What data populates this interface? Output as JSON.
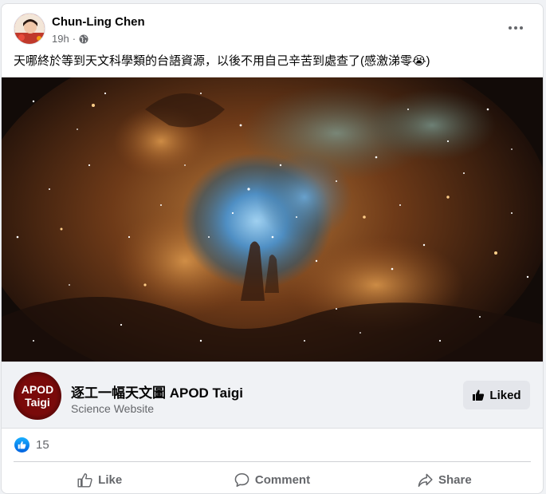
{
  "post": {
    "author": "Chun-Ling Chen",
    "time": "19h",
    "separator": "·",
    "caption": "天哪終於等到天文科學類的台語資源，以後不用自己辛苦到處查了(感激涕零😭)",
    "privacy_icon": "globe-icon",
    "more_icon": "more-options-icon"
  },
  "link_preview": {
    "page_name": "逐工一幅天文圖 APOD Taigi",
    "category": "Science Website",
    "logo_line1": "APOD",
    "logo_line2": "Taigi",
    "button_label": "Liked"
  },
  "reactions": {
    "count": "15"
  },
  "actions": {
    "like": "Like",
    "comment": "Comment",
    "share": "Share"
  },
  "colors": {
    "accent": "#1877f2",
    "secondary_text": "#65676b",
    "card_bg": "#f0f2f5"
  }
}
